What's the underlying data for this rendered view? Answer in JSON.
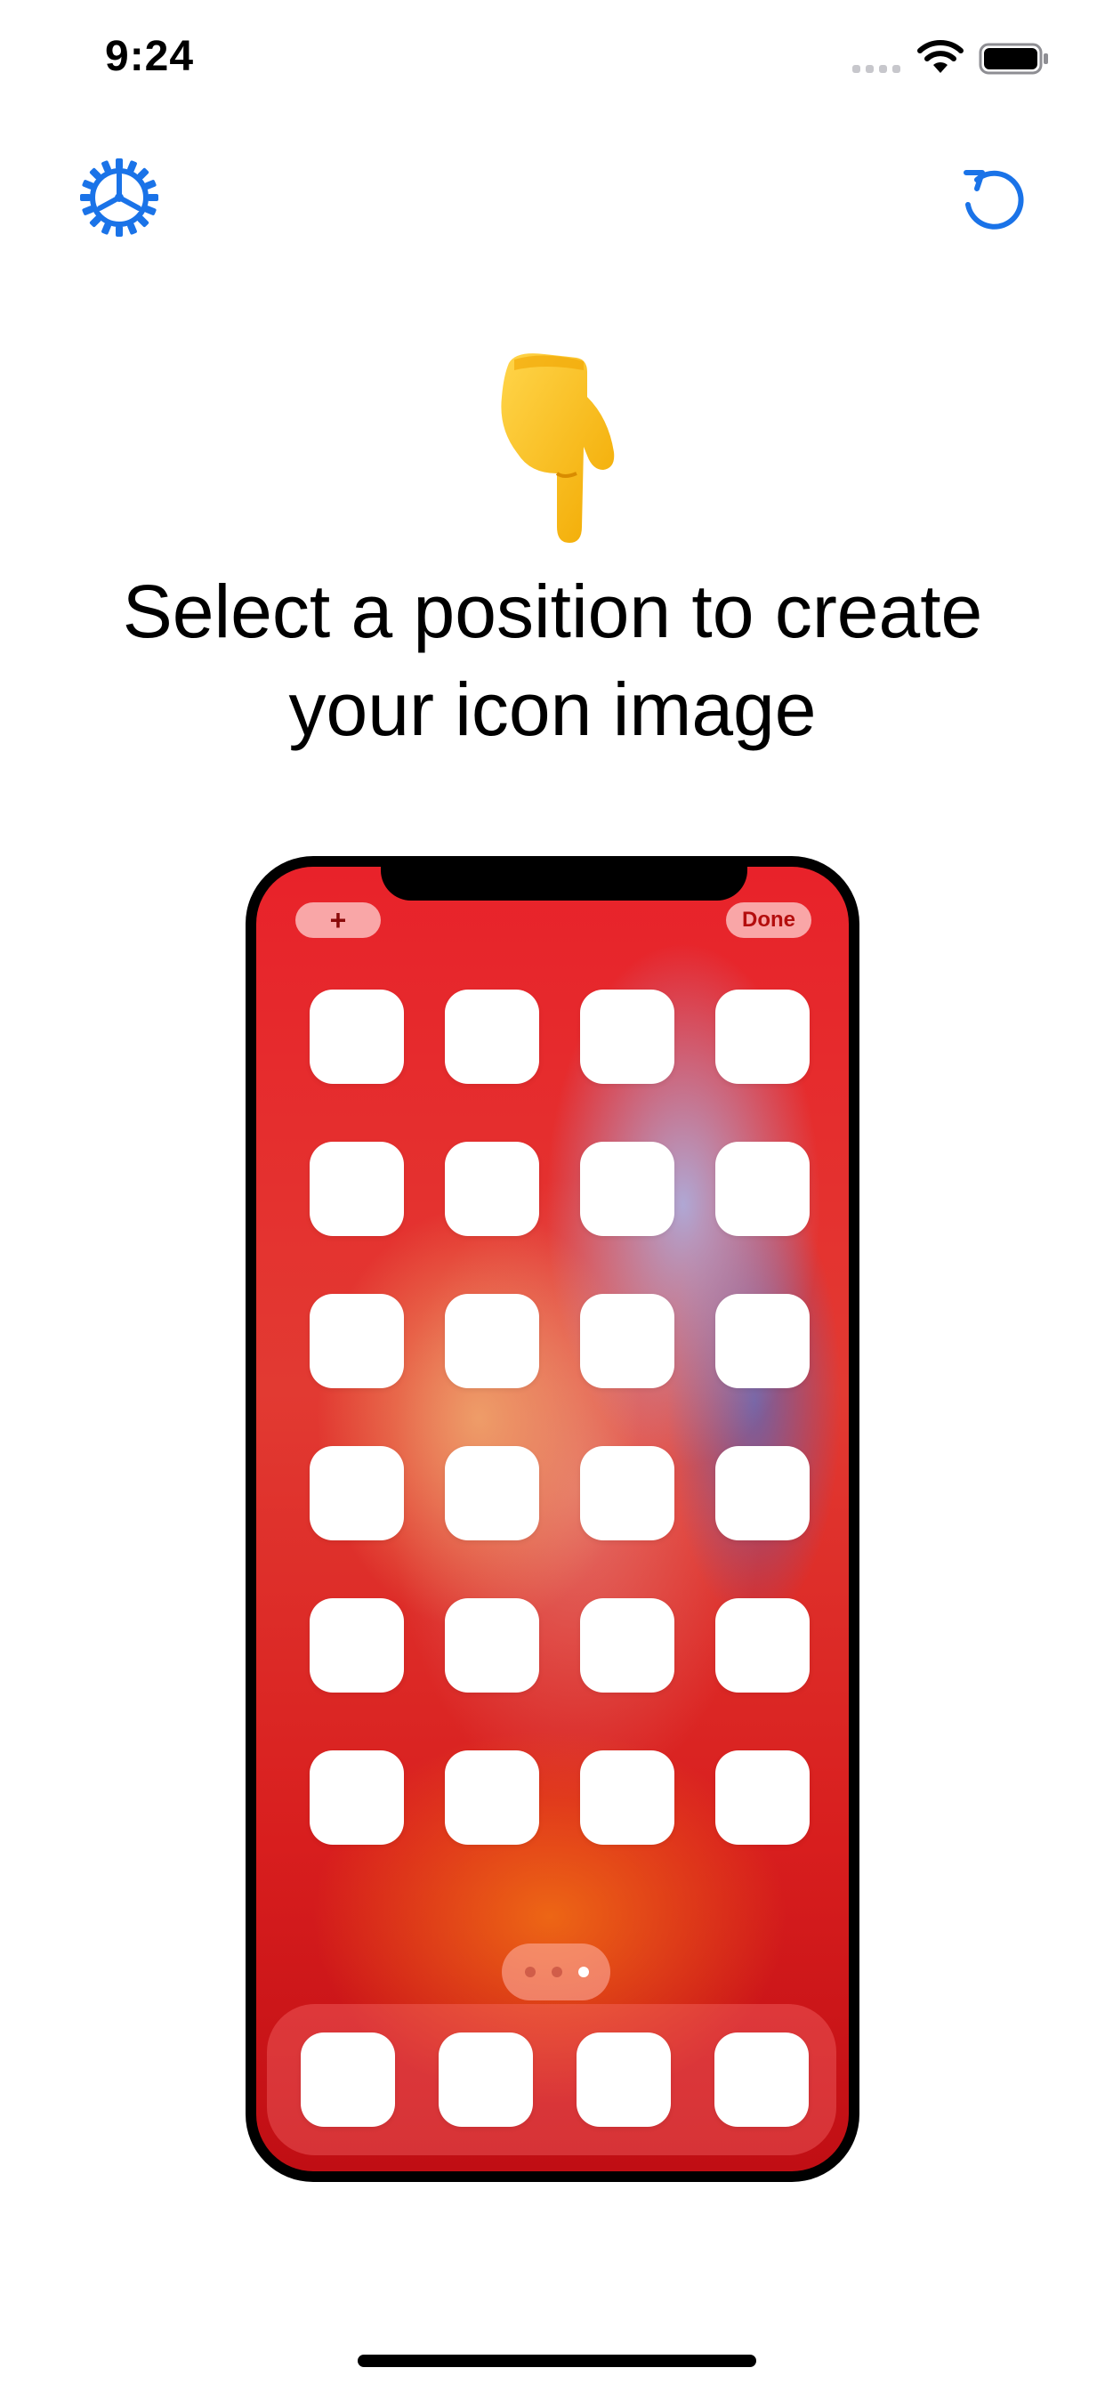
{
  "status_bar": {
    "time": "9:24"
  },
  "icons": {
    "settings": "gear-icon",
    "refresh": "rotate-left-icon",
    "pointer": "backhand-index-pointing-down-icon",
    "wifi": "wifi-icon",
    "battery": "battery-icon"
  },
  "instruction": {
    "line1": "Select a position to create",
    "line2": "your icon image"
  },
  "phone_preview": {
    "add_label": "+",
    "done_label": "Done",
    "grid_rows": 6,
    "grid_columns": 4,
    "dock_slots": 4,
    "page_count": 3,
    "current_page": 3
  },
  "colors": {
    "accent": "#1a73e8",
    "wallpaper_base": "#e8222a"
  }
}
